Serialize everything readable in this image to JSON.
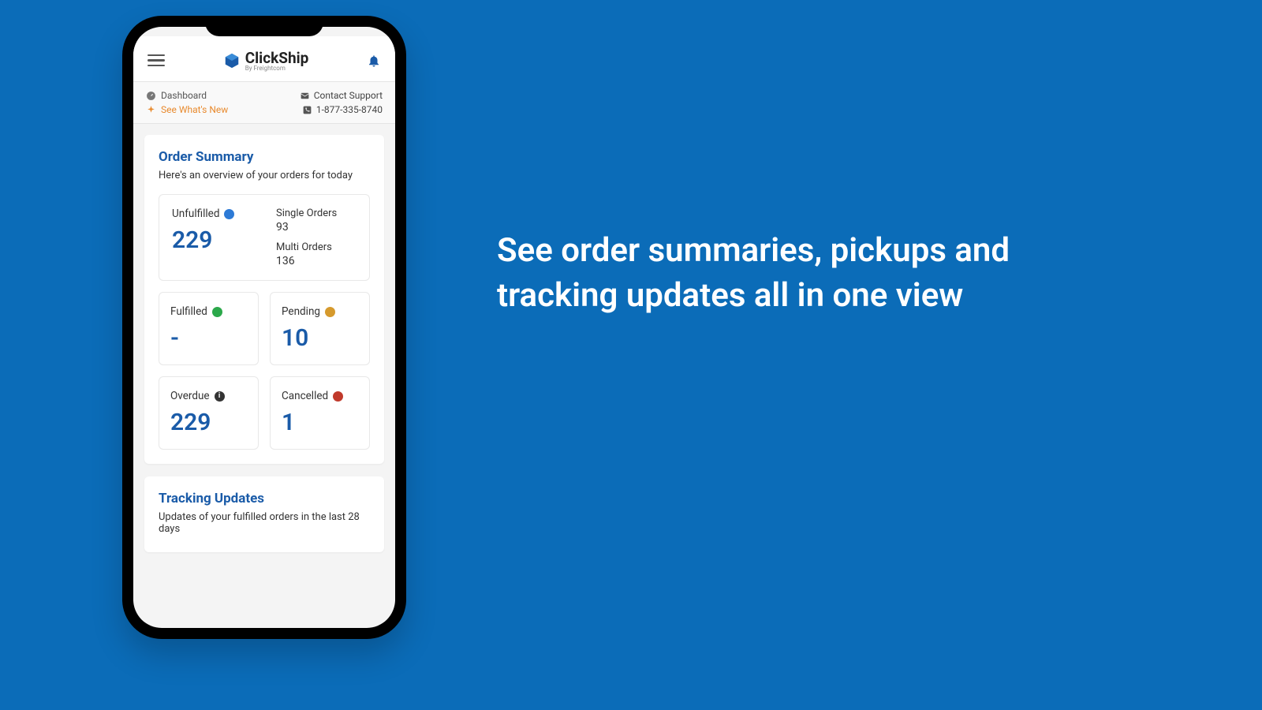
{
  "header": {
    "brand_name": "ClickShip",
    "brand_sub": "By Freightcom"
  },
  "subbar": {
    "dashboard_label": "Dashboard",
    "see_new_label": "See What's New",
    "contact_label": "Contact Support",
    "phone": "1-877-335-8740"
  },
  "order_summary": {
    "title": "Order Summary",
    "subtitle": "Here's an overview of your orders for today",
    "unfulfilled": {
      "label": "Unfulfilled",
      "value": "229"
    },
    "single": {
      "label": "Single Orders",
      "value": "93"
    },
    "multi": {
      "label": "Multi Orders",
      "value": "136"
    },
    "fulfilled": {
      "label": "Fulfilled",
      "value": "-"
    },
    "pending": {
      "label": "Pending",
      "value": "10"
    },
    "overdue": {
      "label": "Overdue",
      "value": "229"
    },
    "cancelled": {
      "label": "Cancelled",
      "value": "1"
    }
  },
  "tracking": {
    "title": "Tracking Updates",
    "subtitle": "Updates of your fulfilled orders in the last 28 days"
  },
  "marketing_text": "See order summaries, pickups and tracking updates all in one view"
}
